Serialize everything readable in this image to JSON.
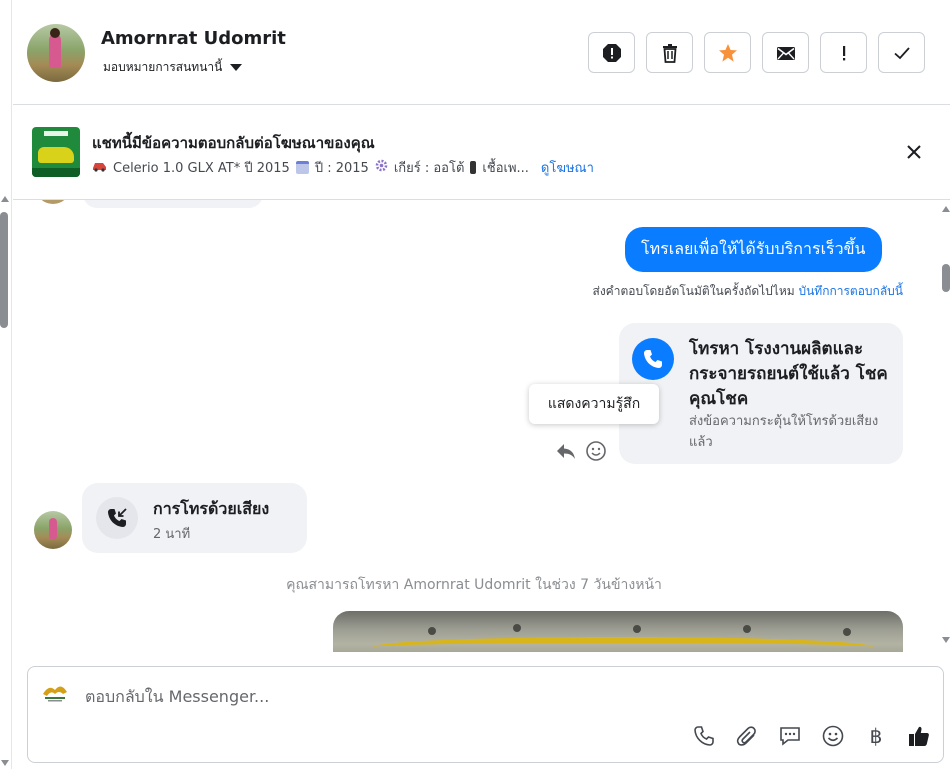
{
  "header": {
    "contact_name": "Amornrat Udomrit",
    "assign_label": "มอบหมายการสนทนานี้",
    "actions": [
      "mark-spam",
      "delete",
      "star",
      "mark-unread",
      "follow-up",
      "done"
    ]
  },
  "ad_banner": {
    "title": "แชทนี้มีข้อความตอบกลับต่อโฆษณาของคุณ",
    "details": [
      {
        "icon": "car-icon",
        "text": "Celerio 1.0 GLX AT* ปี 2015"
      },
      {
        "icon": "calendar-icon",
        "text": "ปี : 2015"
      },
      {
        "icon": "gear-icon",
        "text": "เกียร์ : ออโต้"
      },
      {
        "icon": "fuel-icon",
        "text": "เชื้อเพ..."
      }
    ],
    "link": "ดูโฆษณา"
  },
  "messages": {
    "outgoing_text": "โทรเลยเพื่อให้ได้รับบริการเร็วขึ้น",
    "auto_note": "ส่งคำตอบโดยอัตโนมัติในครั้งถัดไปไหม",
    "auto_note_link": "บันทึกการตอบกลับนี้",
    "call_card": {
      "title": "โทรหา โรงงานผลิตและกระจายรถยนต์ใช้แล้ว โชคคุณโชค",
      "subtitle": "ส่งข้อความกระตุ้นให้โทรด้วยเสียงแล้ว"
    },
    "tooltip": "แสดงความรู้สึก",
    "voice_call": {
      "title": "การโทรด้วยเสียง",
      "duration": "2 นาที"
    },
    "info_line": "คุณสามารถโทรหา Amornrat Udomrit ในช่วง 7 วันข้างหน้า"
  },
  "composer": {
    "placeholder": "ตอบกลับใน Messenger...",
    "value": "",
    "tools": [
      "phone-icon",
      "attachment-icon",
      "saved-reply-icon",
      "emoji-icon",
      "baht-icon",
      "like-icon"
    ],
    "baht_symbol": "฿"
  },
  "colors": {
    "accent": "#0a7cff",
    "link": "#1b74e4",
    "star": "#f7923b",
    "bubble_bg": "#f0f2f5"
  }
}
